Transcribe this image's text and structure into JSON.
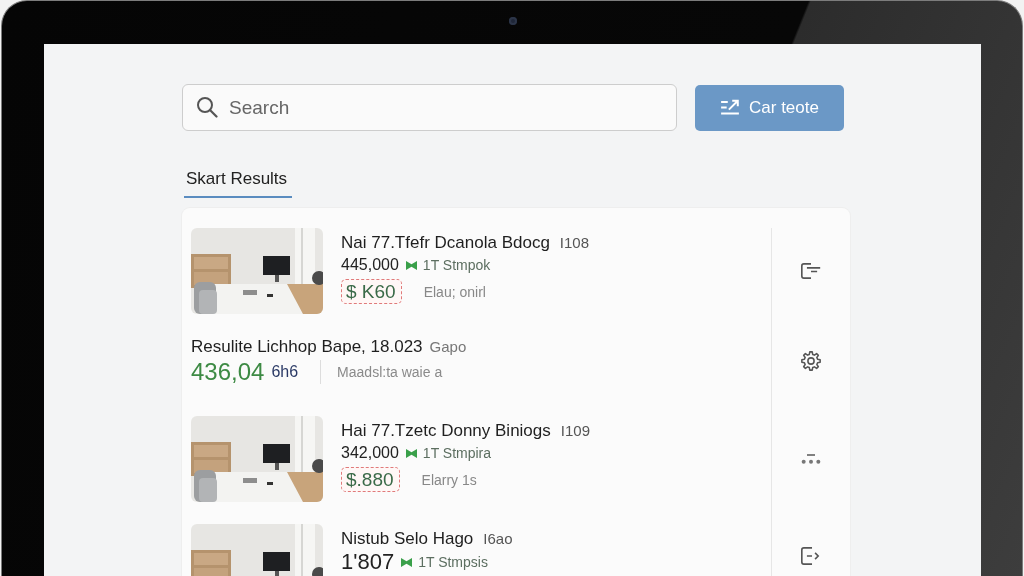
{
  "search": {
    "placeholder": "Search"
  },
  "action_button": {
    "label": "Car teote"
  },
  "tabs": [
    {
      "label": "Skart Results",
      "selected": true
    }
  ],
  "results": [
    {
      "kind": "listing",
      "title": "Nai 77.Tfefr Dcanola Bdocg",
      "code": "I108",
      "price": "445,000",
      "tag": "1T Stmpok",
      "badge": "$ K60",
      "note": "Elau; onirl"
    },
    {
      "kind": "summary",
      "title": "Resulite Lichhop Bape, 18.023",
      "suffix": "Gapo",
      "amount": "436,04",
      "unit": "6h6",
      "note": "Maadsl:ta waie a"
    },
    {
      "kind": "listing",
      "title": "Hai 77.Tzetc Donny Biniogs",
      "code": "I109",
      "price": "342,000",
      "tag": "1T Stmpira",
      "badge": "$.880",
      "note": "Elarry 1s"
    },
    {
      "kind": "preview",
      "title": "Nistub Selo Hago",
      "code": "I6ao",
      "price": "1'807",
      "tag": "1T Stmpsis"
    }
  ]
}
